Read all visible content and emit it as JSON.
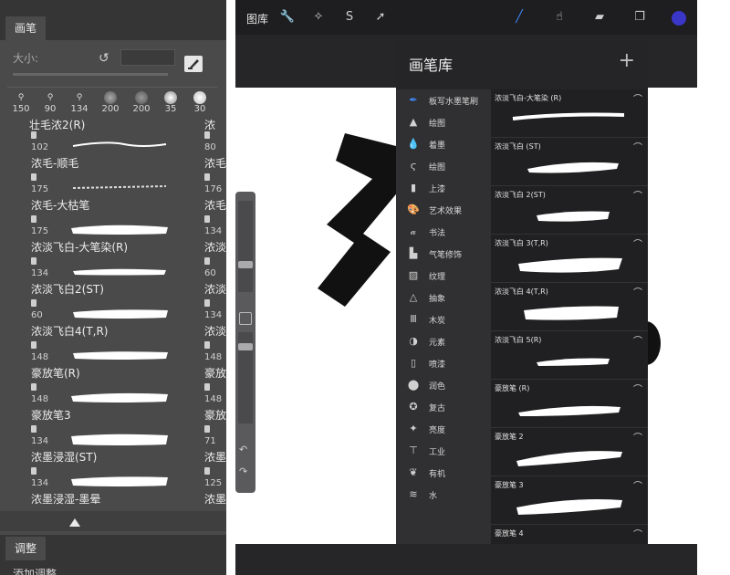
{
  "photoshop": {
    "panel_tab": "画笔",
    "size_label": "大小:",
    "presets": [
      "150",
      "90",
      "134",
      "200",
      "200",
      "35",
      "30"
    ],
    "top_partial_label": "壮毛浓2(R)",
    "top_partial_label_right": "浓",
    "brushes": [
      {
        "size": "102",
        "name": "浓毛-顺毛",
        "right_size": "80",
        "right_name": "浓毛"
      },
      {
        "size": "175",
        "name": "浓毛-大枯笔",
        "right_size": "176",
        "right_name": "浓毛"
      },
      {
        "size": "175",
        "name": "浓淡飞白-大笔染(R)",
        "right_size": "134",
        "right_name": "浓淡"
      },
      {
        "size": "134",
        "name": "浓淡飞白2(ST)",
        "right_size": "60",
        "right_name": "浓淡"
      },
      {
        "size": "60",
        "name": "浓淡飞白4(T,R)",
        "right_size": "134",
        "right_name": "浓淡"
      },
      {
        "size": "148",
        "name": "豪放笔(R)",
        "right_size": "148",
        "right_name": "豪放"
      },
      {
        "size": "148",
        "name": "豪放笔3",
        "right_size": "148",
        "right_name": "豪放"
      },
      {
        "size": "134",
        "name": "浓墨浸湿(ST)",
        "right_size": "71",
        "right_name": "浓墨"
      },
      {
        "size": "134",
        "name": "浓墨浸湿-墨晕",
        "right_size": "125",
        "right_name": "浓墨"
      }
    ],
    "adjust_tab": "调整",
    "adjust_sub": "添加调整"
  },
  "procreate": {
    "gallery": "图库",
    "toolbar_icons": [
      "wrench-icon",
      "magic-wand-icon",
      "selection-icon",
      "transform-icon"
    ],
    "right_tools": [
      "brush-icon",
      "smudge-icon",
      "eraser-icon",
      "layers-icon"
    ],
    "color_swatch": "#3a36c8",
    "library_title": "画笔库",
    "categories": [
      {
        "label": "板写水墨笔刷",
        "active": true
      },
      {
        "label": "绘图",
        "active": false
      },
      {
        "label": "着墨",
        "active": false
      },
      {
        "label": "绘图",
        "active": false
      },
      {
        "label": "上漆",
        "active": false
      },
      {
        "label": "艺术效果",
        "active": false
      },
      {
        "label": "书法",
        "active": false
      },
      {
        "label": "气笔修饰",
        "active": false
      },
      {
        "label": "纹理",
        "active": false
      },
      {
        "label": "抽象",
        "active": false
      },
      {
        "label": "木炭",
        "active": false
      },
      {
        "label": "元素",
        "active": false
      },
      {
        "label": "喷漆",
        "active": false
      },
      {
        "label": "润色",
        "active": false
      },
      {
        "label": "复古",
        "active": false
      },
      {
        "label": "亮度",
        "active": false
      },
      {
        "label": "工业",
        "active": false
      },
      {
        "label": "有机",
        "active": false
      },
      {
        "label": "水",
        "active": false
      }
    ],
    "brushes": [
      "浓淡飞白-大笔染 (R)",
      "浓淡飞白 (ST)",
      "浓淡飞白 2(ST)",
      "浓淡飞白 3(T,R)",
      "浓淡飞白 4(T,R)",
      "浓淡飞白 5(R)",
      "豪放笔 (R)",
      "豪放笔 2",
      "豪放笔 3",
      "豪放笔 4"
    ]
  }
}
